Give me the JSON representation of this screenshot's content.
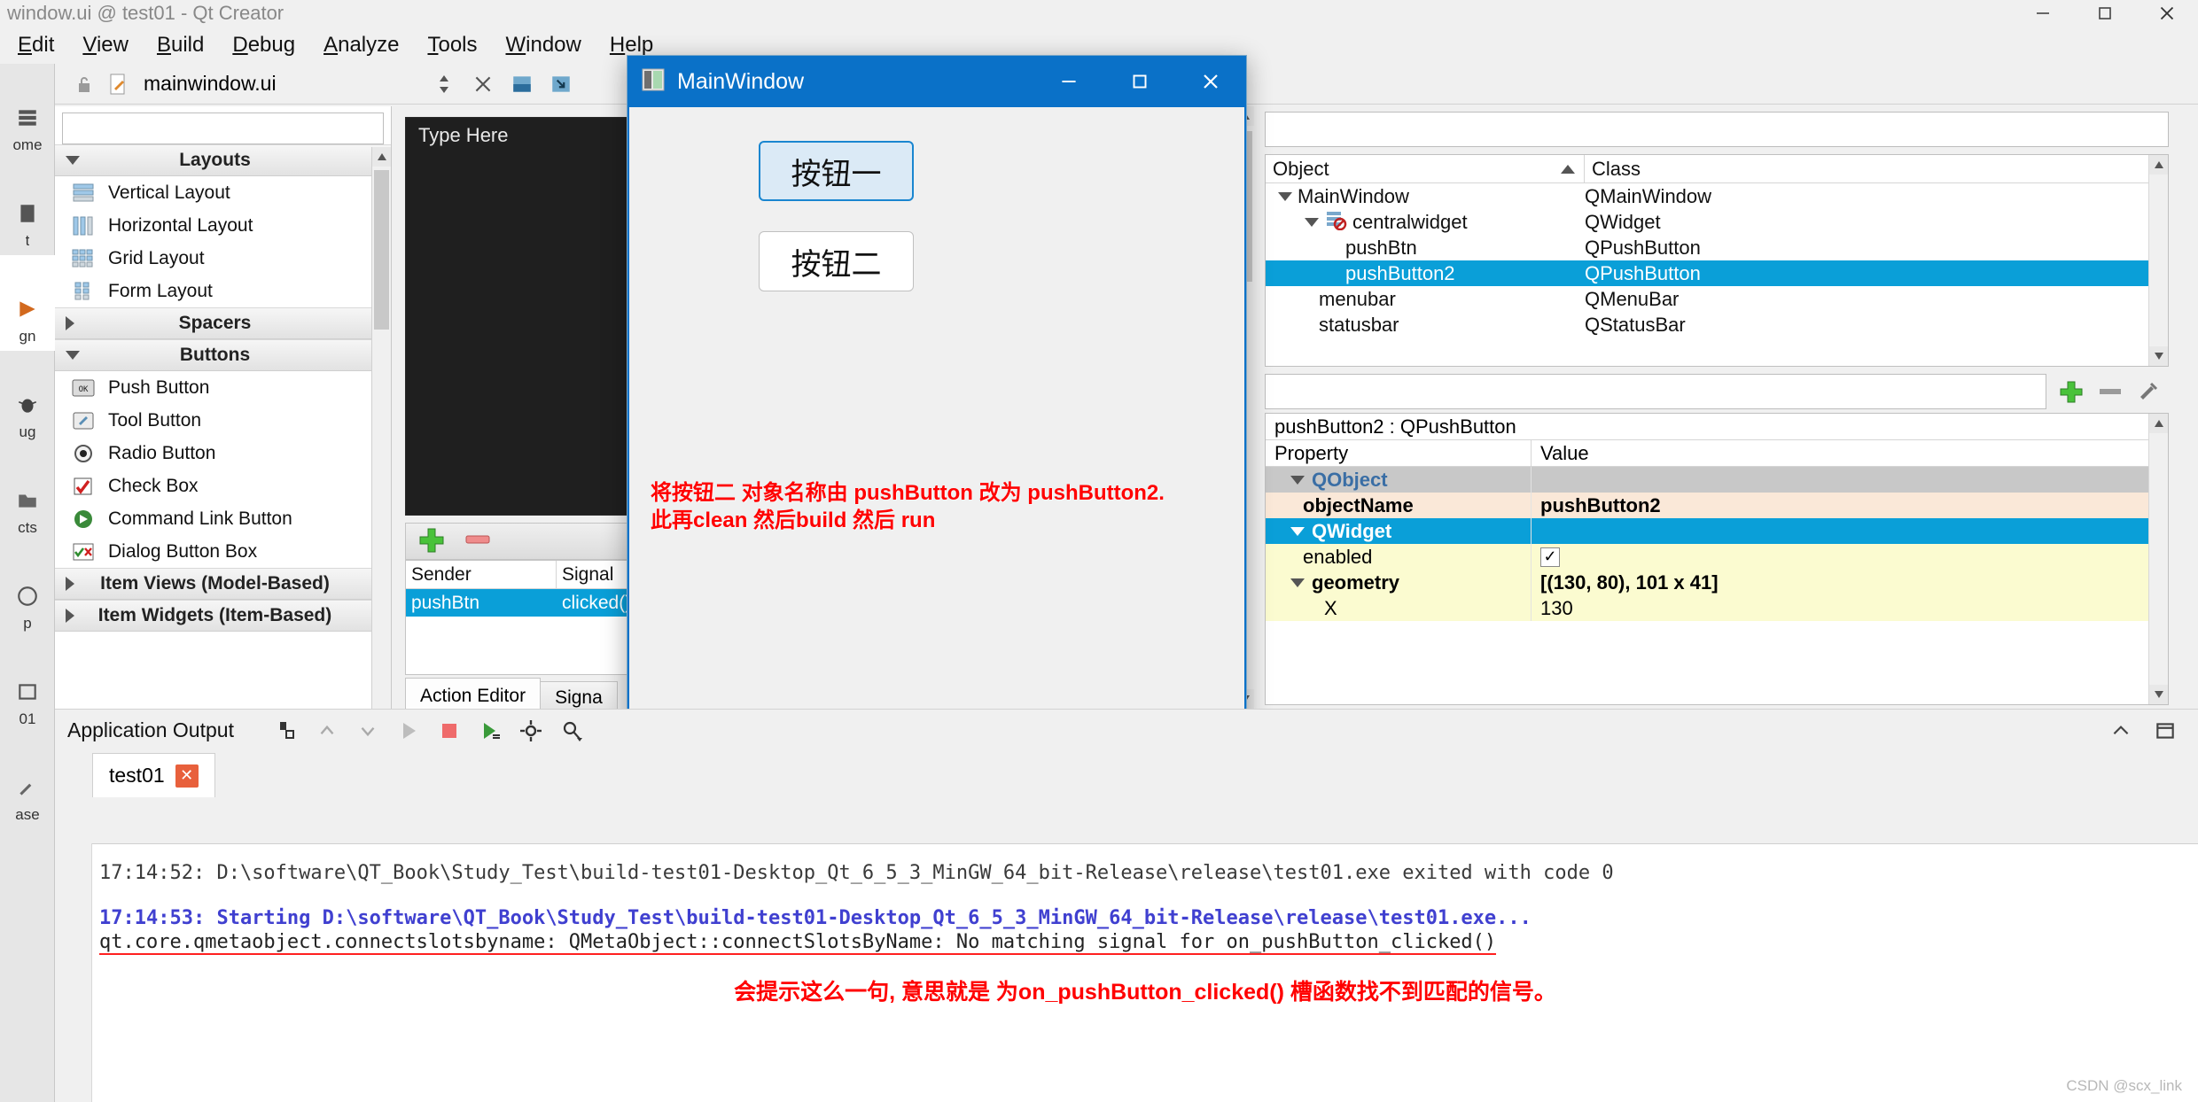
{
  "window": {
    "title": "window.ui @ test01 - Qt Creator",
    "controls": {
      "minimize": "minimize-icon",
      "maximize": "maximize-icon",
      "close": "close-icon"
    }
  },
  "menubar": {
    "items": [
      {
        "label": "Edit",
        "mnemonic": "E"
      },
      {
        "label": "View",
        "mnemonic": "V"
      },
      {
        "label": "Build",
        "mnemonic": "B"
      },
      {
        "label": "Debug",
        "mnemonic": "D"
      },
      {
        "label": "Analyze",
        "mnemonic": "A"
      },
      {
        "label": "Tools",
        "mnemonic": "T"
      },
      {
        "label": "Window",
        "mnemonic": "W"
      },
      {
        "label": "Help",
        "mnemonic": "H"
      }
    ]
  },
  "modebar": {
    "items": [
      {
        "label": "ome",
        "icon": "welcome-icon",
        "active": false
      },
      {
        "label": "t",
        "icon": "edit-icon",
        "active": false
      },
      {
        "label": "gn",
        "icon": "design-icon",
        "active": true
      },
      {
        "label": "ug",
        "icon": "debug-icon",
        "active": false
      },
      {
        "label": "cts",
        "icon": "projects-icon",
        "active": false
      },
      {
        "label": "p",
        "icon": "help-icon",
        "active": false
      },
      {
        "label": "01",
        "icon": "project-icon",
        "active": false
      },
      {
        "label": "ase",
        "icon": "build-icon",
        "active": false
      }
    ]
  },
  "editor_toolbar": {
    "file_name": "mainwindow.ui",
    "lock_icon": "unlocked-icon",
    "file_icon": "ui-file-icon",
    "updown_icon": "updown-arrows-icon",
    "close_icon": "close-document-icon",
    "split_icon": "split-horizontal-icon",
    "split2_icon": "split-vertical-icon"
  },
  "widget_box": {
    "filter_placeholder": "",
    "groups": [
      {
        "name": "Layouts",
        "expanded": true,
        "items": [
          {
            "label": "Vertical Layout",
            "icon": "vertical-layout-icon"
          },
          {
            "label": "Horizontal Layout",
            "icon": "horizontal-layout-icon"
          },
          {
            "label": "Grid Layout",
            "icon": "grid-layout-icon"
          },
          {
            "label": "Form Layout",
            "icon": "form-layout-icon"
          }
        ]
      },
      {
        "name": "Spacers",
        "expanded": false,
        "items": []
      },
      {
        "name": "Buttons",
        "expanded": true,
        "items": [
          {
            "label": "Push Button",
            "icon": "push-button-icon"
          },
          {
            "label": "Tool Button",
            "icon": "tool-button-icon"
          },
          {
            "label": "Radio Button",
            "icon": "radio-button-icon"
          },
          {
            "label": "Check Box",
            "icon": "check-box-icon"
          },
          {
            "label": "Command Link Button",
            "icon": "command-link-icon"
          },
          {
            "label": "Dialog Button Box",
            "icon": "dialog-button-box-icon"
          }
        ]
      },
      {
        "name": "Item Views (Model-Based)",
        "expanded": false,
        "items": []
      },
      {
        "name": "Item Widgets (Item-Based)",
        "expanded": false,
        "items": []
      }
    ]
  },
  "form_editor": {
    "type_here": "Type Here",
    "signal_toolbar": {
      "add_icon": "plus-icon",
      "remove_icon": "minus-icon"
    },
    "signal_table": {
      "columns": [
        "Sender",
        "Signal"
      ],
      "rows": [
        {
          "sender": "pushBtn",
          "signal": "clicked()",
          "selected": true
        }
      ]
    },
    "tabs": [
      {
        "label": "Action Editor",
        "active": true
      },
      {
        "label": "Signa",
        "active": false
      }
    ]
  },
  "object_inspector": {
    "filter_value": "",
    "columns": [
      "Object",
      "Class"
    ],
    "rows": [
      {
        "object": "MainWindow",
        "class": "QMainWindow",
        "indent": 0,
        "expander": "down",
        "icon": "",
        "selected": false
      },
      {
        "object": "centralwidget",
        "class": "QWidget",
        "indent": 1,
        "expander": "down",
        "icon": "no-layout-icon",
        "selected": false
      },
      {
        "object": "pushBtn",
        "class": "QPushButton",
        "indent": 2,
        "expander": "",
        "icon": "",
        "selected": false
      },
      {
        "object": "pushButton2",
        "class": "QPushButton",
        "indent": 2,
        "expander": "",
        "icon": "",
        "selected": true
      },
      {
        "object": "menubar",
        "class": "QMenuBar",
        "indent": 1,
        "expander": "",
        "icon": "",
        "selected": false
      },
      {
        "object": "statusbar",
        "class": "QStatusBar",
        "indent": 1,
        "expander": "",
        "icon": "",
        "selected": false
      }
    ]
  },
  "property_toolbar": {
    "filter_value": "",
    "buttons": [
      "plus-icon",
      "minus-icon",
      "configure-icon"
    ]
  },
  "property_editor": {
    "header": "pushButton2 : QPushButton",
    "columns": [
      "Property",
      "Value"
    ],
    "rows": [
      {
        "property": "QObject",
        "value": "",
        "kind": "group",
        "expander": "down",
        "selected": false
      },
      {
        "property": "objectName",
        "value": "pushButton2",
        "kind": "orange",
        "expander": "",
        "selected": false
      },
      {
        "property": "QWidget",
        "value": "",
        "kind": "group",
        "expander": "down",
        "selected": true
      },
      {
        "property": "enabled",
        "value": "",
        "kind": "yellow",
        "expander": "",
        "checkbox": true,
        "checked": true
      },
      {
        "property": "geometry",
        "value": "[(130, 80), 101 x 41]",
        "kind": "yellow-bold",
        "expander": "down",
        "selected": false
      },
      {
        "property": "X",
        "value": "130",
        "kind": "yellow",
        "expander": "",
        "indent": true,
        "selected": false
      }
    ]
  },
  "preview_window": {
    "title": "MainWindow",
    "icon": "app-icon",
    "controls": {
      "minimize": "minimize-icon",
      "maximize": "maximize-icon",
      "close": "close-icon"
    },
    "buttons": [
      {
        "label": "按钮一",
        "focused": true
      },
      {
        "label": "按钮二",
        "focused": false
      }
    ],
    "annotation_line1": "将按钮二 对象名称由 pushButton 改为 pushButton2.",
    "annotation_line2": "此再clean 然后build 然后 run"
  },
  "output_pane": {
    "title": "Application Output",
    "toolbar_icons": [
      "clear-icon",
      "prev-item-icon",
      "next-item-icon",
      "run-icon",
      "stop-icon",
      "run-debug-icon",
      "settings-icon",
      "filter-icon"
    ],
    "right_icons": [
      "collapse-icon",
      "maximize-pane-icon"
    ],
    "tabs": [
      {
        "label": "test01",
        "close_icon": "close-tab-icon",
        "active": true
      }
    ],
    "lines": [
      {
        "text": "17:14:52: D:\\software\\QT_Book\\Study_Test\\build-test01-Desktop_Qt_6_5_3_MinGW_64_bit-Release\\release\\test01.exe exited with code 0",
        "style": "normal"
      },
      {
        "text": "17:14:53: Starting D:\\software\\QT_Book\\Study_Test\\build-test01-Desktop_Qt_6_5_3_MinGW_64_bit-Release\\release\\test01.exe...",
        "style": "blue"
      },
      {
        "text": "qt.core.qmetaobject.connectslotsbyname: QMetaObject::connectSlotsByName: No matching signal for on_pushButton_clicked()",
        "style": "underlined"
      }
    ],
    "annotation": "会提示这么一句, 意思就是 为on_pushButton_clicked() 槽函数找不到匹配的信号。"
  },
  "watermark": "CSDN @scx_link",
  "colors": {
    "accent_blue": "#0a9fd8",
    "title_blue": "#0a71c8",
    "annotation_red": "#ff0000",
    "output_blue": "#4040d0"
  }
}
